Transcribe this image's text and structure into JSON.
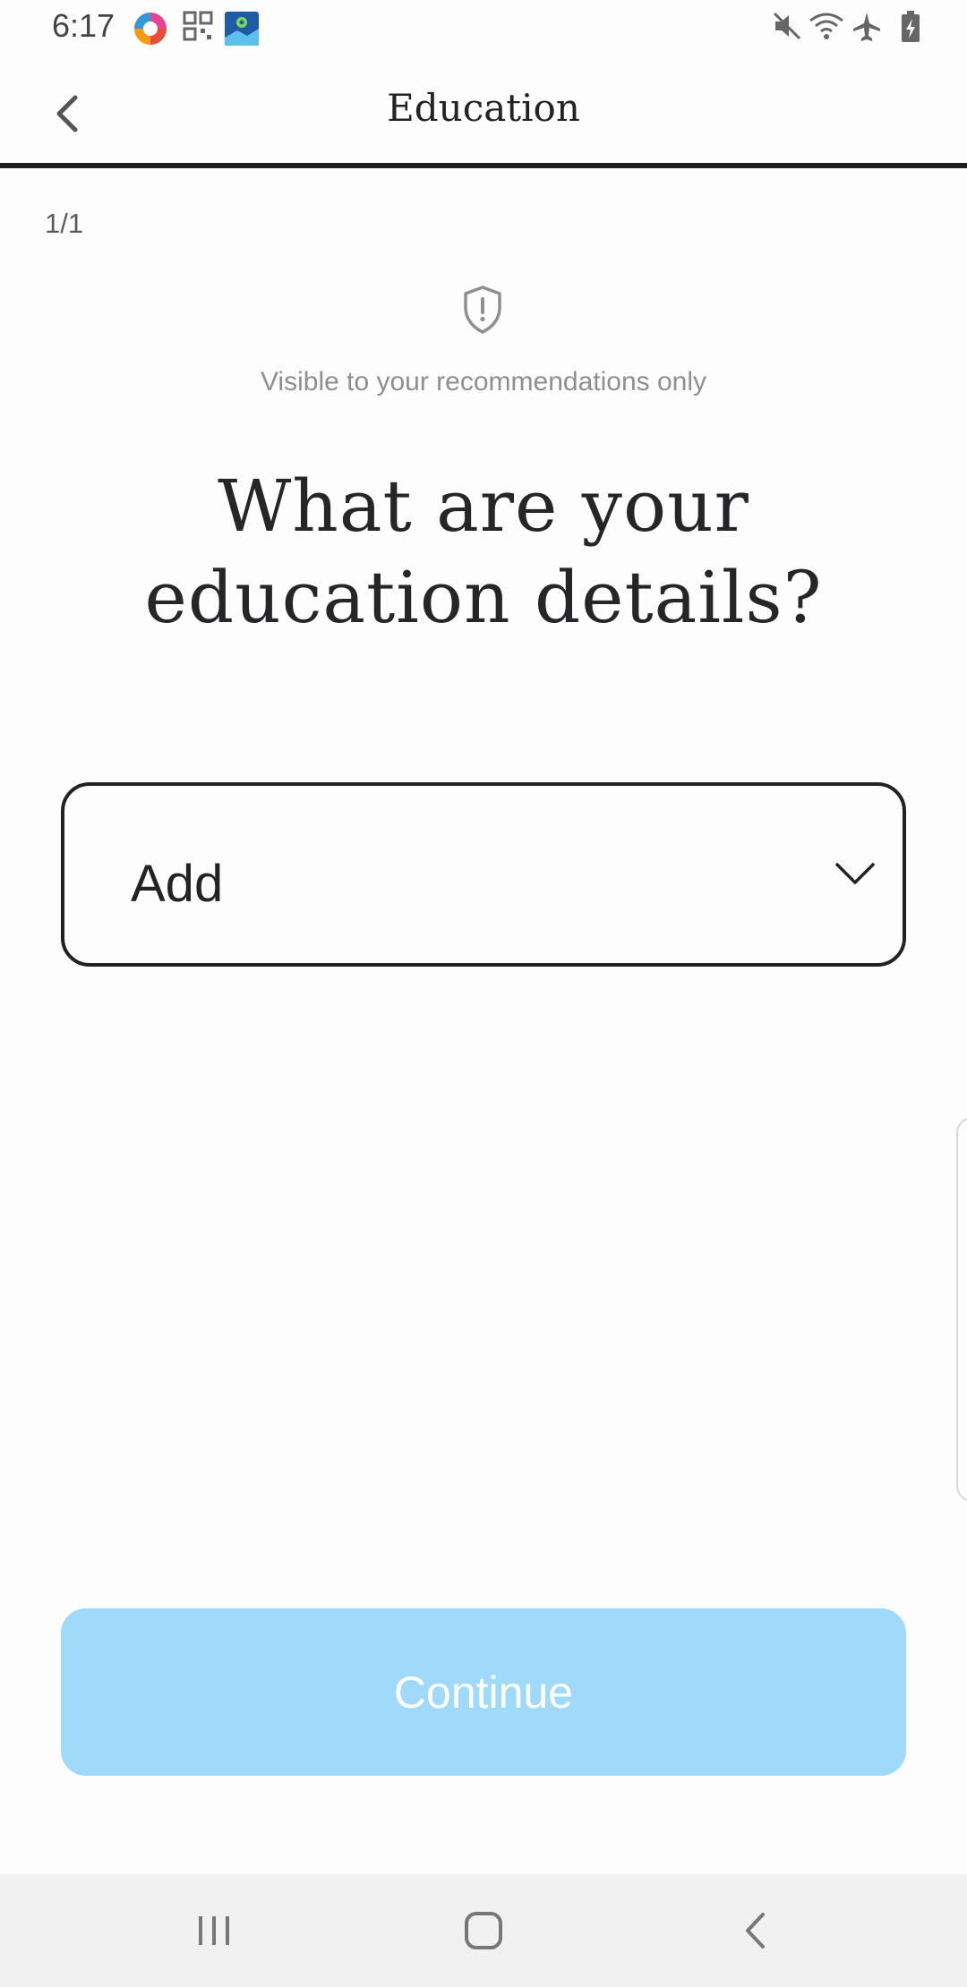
{
  "status_bar": {
    "time": "6:17",
    "left_icons": [
      "browser-app-icon",
      "qr-scanner-icon",
      "maps-app-icon"
    ],
    "right_icons": [
      "mute-icon",
      "wifi-icon",
      "airplane-mode-icon",
      "battery-charging-icon"
    ]
  },
  "header": {
    "title": "Education",
    "back_icon": "chevron-left-icon"
  },
  "step": {
    "counter": "1/1"
  },
  "visibility": {
    "icon": "shield-alert-icon",
    "note": "Visible to your recommendations only"
  },
  "question": {
    "line1": "What are your",
    "line2": "education details?"
  },
  "education_select": {
    "label": "Add",
    "icon": "chevron-down-icon"
  },
  "continue_button": {
    "label": "Continue",
    "state": "disabled"
  },
  "navigation_bar": {
    "buttons": [
      "recent-apps-icon",
      "home-icon",
      "back-icon"
    ]
  },
  "colors": {
    "background": "#fefdfd",
    "text_primary": "#232326",
    "text_muted": "#8e8e93",
    "continue_disabled": "#a0dafa",
    "nav_bar": "#f1f1f1"
  }
}
